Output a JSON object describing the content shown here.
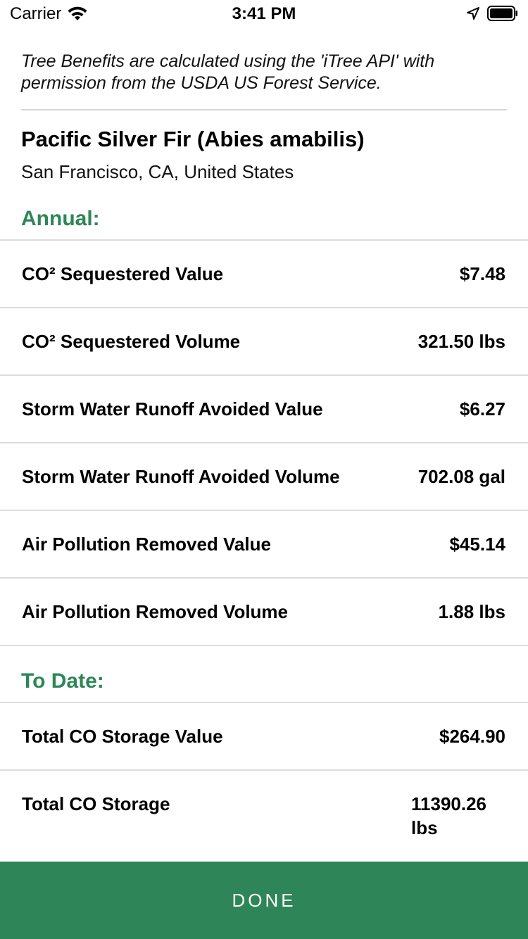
{
  "status_bar": {
    "carrier": "Carrier",
    "time": "3:41 PM",
    "icons": [
      "wifi-icon",
      "location-arrow-icon",
      "battery-icon"
    ]
  },
  "disclaimer": "Tree Benefits are calculated using the 'iTree API' with permission from the USDA US Forest Service.",
  "tree": {
    "name": "Pacific Silver Fir (Abies amabilis)",
    "location": "San Francisco, CA, United States"
  },
  "annual": {
    "header": "Annual:",
    "rows": [
      {
        "label": "CO² Sequestered Value",
        "value": "$7.48"
      },
      {
        "label": "CO² Sequestered Volume",
        "value": "321.50 lbs"
      },
      {
        "label": "Storm Water Runoff Avoided Value",
        "value": "$6.27"
      },
      {
        "label": "Storm Water Runoff Avoided Volume",
        "value": "702.08 gal"
      },
      {
        "label": "Air Pollution Removed Value",
        "value": "$45.14"
      },
      {
        "label": "Air Pollution Removed Volume",
        "value": "1.88 lbs"
      }
    ]
  },
  "to_date": {
    "header": "To Date:",
    "rows": [
      {
        "label": "Total CO Storage Value",
        "value": "$264.90"
      },
      {
        "label": "Total CO Storage",
        "value": "11390.26 lbs"
      }
    ]
  },
  "done_label": "DONE",
  "colors": {
    "accent": "#2e8658",
    "divider": "#dcdcdc"
  }
}
